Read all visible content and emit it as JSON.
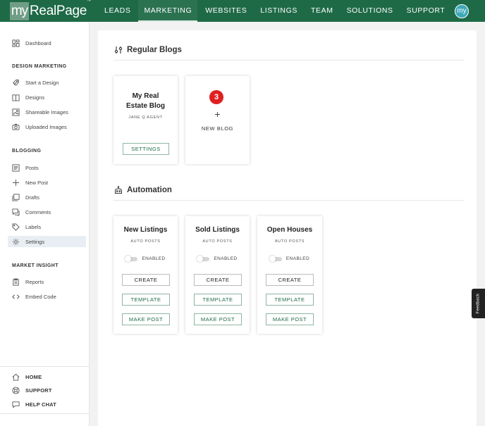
{
  "brand": {
    "logo_my": "my",
    "logo_name": "RealPage",
    "logo_tm": "™"
  },
  "nav": {
    "items": [
      {
        "label": "LEADS",
        "active": false
      },
      {
        "label": "MARKETING",
        "active": true
      },
      {
        "label": "WEBSITES",
        "active": false
      },
      {
        "label": "LISTINGS",
        "active": false
      },
      {
        "label": "TEAM",
        "active": false
      },
      {
        "label": "SOLUTIONS",
        "active": false
      },
      {
        "label": "SUPPORT",
        "active": false
      }
    ],
    "avatar_text": "my"
  },
  "sidebar": {
    "dashboard": "Dashboard",
    "design_marketing": {
      "heading": "DESIGN MARKETING",
      "items": [
        "Start a Design",
        "Designs",
        "Shareable Images",
        "Uploaded Images"
      ]
    },
    "blogging": {
      "heading": "BLOGGING",
      "items": [
        "Posts",
        "New Post",
        "Drafts",
        "Comments",
        "Labels",
        "Settings"
      ],
      "active": "Settings"
    },
    "market_insight": {
      "heading": "MARKET INSIGHT",
      "items": [
        "Reports",
        "Embed Code"
      ]
    },
    "bottom": [
      "HOME",
      "SUPPORT",
      "HELP CHAT"
    ]
  },
  "regular_blogs": {
    "title": "Regular Blogs",
    "blog_card": {
      "title_line1": "My Real",
      "title_line2": "Estate Blog",
      "author": "JANE Q AGENT",
      "settings_label": "SETTINGS"
    },
    "new_blog_card": {
      "badge": "3",
      "plus": "+",
      "label": "NEW BLOG"
    }
  },
  "automation": {
    "title": "Automation",
    "cards": [
      {
        "title": "New Listings",
        "subtitle": "AUTO POSTS",
        "toggle_label": "ENABLED",
        "create": "CREATE",
        "template": "TEMPLATE",
        "make_post": "MAKE POST"
      },
      {
        "title": "Sold Listings",
        "subtitle": "AUTO POSTS",
        "toggle_label": "ENABLED",
        "create": "CREATE",
        "template": "TEMPLATE",
        "make_post": "MAKE POST"
      },
      {
        "title": "Open Houses",
        "subtitle": "AUTO POSTS",
        "toggle_label": "ENABLED",
        "create": "CREATE",
        "template": "TEMPLATE",
        "make_post": "MAKE POST"
      }
    ]
  },
  "feedback_label": "Feedback",
  "colors": {
    "brand_green": "#1e6a47",
    "badge_red": "#e02020",
    "avatar_teal": "#3fa8b8"
  }
}
